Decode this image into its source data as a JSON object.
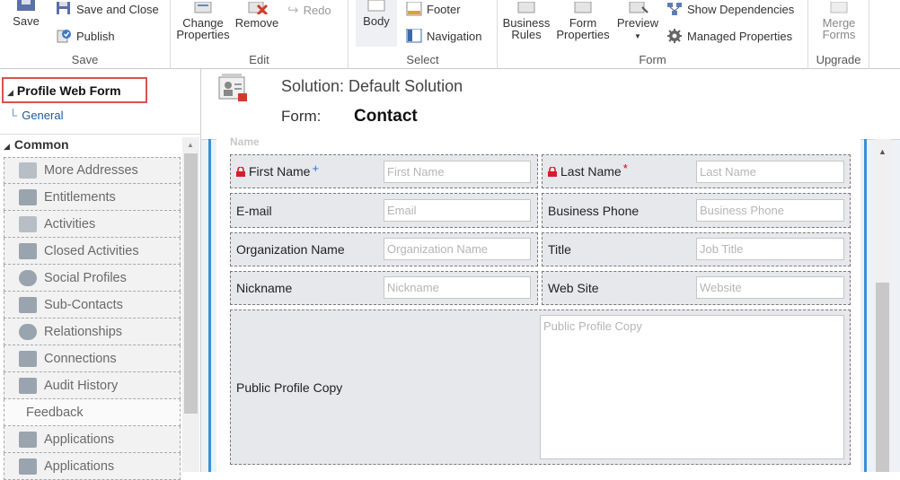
{
  "ribbon": {
    "save_group": {
      "label": "Save",
      "save": "Save",
      "save_and_close": "Save and Close",
      "publish": "Publish"
    },
    "edit_group": {
      "label": "Edit",
      "change_properties_1": "Change",
      "change_properties_2": "Properties",
      "remove": "Remove",
      "redo": "Redo"
    },
    "select_group": {
      "label": "Select",
      "body": "Body",
      "footer": "Footer",
      "navigation": "Navigation"
    },
    "form_group": {
      "label": "Form",
      "business_rules_1": "Business",
      "business_rules_2": "Rules",
      "form_properties_1": "Form",
      "form_properties_2": "Properties",
      "preview": "Preview",
      "show_dependencies": "Show Dependencies",
      "managed_properties": "Managed Properties"
    },
    "upgrade_group": {
      "label": "Upgrade",
      "merge_forms_1": "Merge",
      "merge_forms_2": "Forms"
    }
  },
  "nav": {
    "form_title": "Profile Web Form",
    "general": "General",
    "common": "Common",
    "items": [
      {
        "label": "More Addresses",
        "icon": "address-icon"
      },
      {
        "label": "Entitlements",
        "icon": "entitlements-icon"
      },
      {
        "label": "Activities",
        "icon": "activities-icon"
      },
      {
        "label": "Closed Activities",
        "icon": "closed-activities-icon"
      },
      {
        "label": "Social Profiles",
        "icon": "social-profiles-icon"
      },
      {
        "label": "Sub-Contacts",
        "icon": "sub-contacts-icon"
      },
      {
        "label": "Relationships",
        "icon": "relationships-icon"
      },
      {
        "label": "Connections",
        "icon": "connections-icon"
      },
      {
        "label": "Audit History",
        "icon": "audit-history-icon"
      },
      {
        "label": "Feedback",
        "icon": ""
      },
      {
        "label": "Applications",
        "icon": "applications-icon"
      },
      {
        "label": "Applications",
        "icon": "applications-icon"
      }
    ]
  },
  "header": {
    "solution": "Solution: Default Solution",
    "form_label": "Form:",
    "form_name": "Contact"
  },
  "form": {
    "section_title": "Name",
    "fields": {
      "first_name": {
        "label": "First Name",
        "placeholder": "First Name"
      },
      "last_name": {
        "label": "Last Name",
        "placeholder": "Last Name"
      },
      "email": {
        "label": "E-mail",
        "placeholder": "Email"
      },
      "business_phone": {
        "label": "Business Phone",
        "placeholder": "Business Phone"
      },
      "organization_name": {
        "label": "Organization Name",
        "placeholder": "Organization Name"
      },
      "title": {
        "label": "Title",
        "placeholder": "Job Title"
      },
      "nickname": {
        "label": "Nickname",
        "placeholder": "Nickname"
      },
      "web_site": {
        "label": "Web Site",
        "placeholder": "Website"
      },
      "public_profile_copy": {
        "label": "Public Profile Copy",
        "placeholder": "Public Profile Copy"
      }
    }
  }
}
